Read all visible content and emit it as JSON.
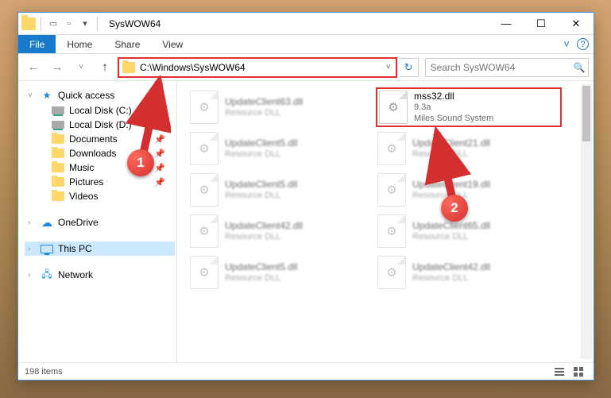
{
  "window": {
    "title": "SysWOW64"
  },
  "ribbon": {
    "file": "File",
    "tabs": [
      "Home",
      "Share",
      "View"
    ]
  },
  "nav": {
    "back_enabled": false,
    "forward_enabled": false,
    "up_enabled": true,
    "path": "C:\\Windows\\SysWOW64",
    "search_placeholder": "Search SysWOW64"
  },
  "sidebar": {
    "quick_access": {
      "label": "Quick access"
    },
    "quick_items": [
      {
        "label": "Local Disk (C:)",
        "pinned": true,
        "type": "drive"
      },
      {
        "label": "Local Disk (D:)",
        "pinned": true,
        "type": "drive"
      },
      {
        "label": "Documents",
        "pinned": true,
        "type": "folder"
      },
      {
        "label": "Downloads",
        "pinned": true,
        "type": "folder"
      },
      {
        "label": "Music",
        "pinned": true,
        "type": "folder"
      },
      {
        "label": "Pictures",
        "pinned": true,
        "type": "folder"
      },
      {
        "label": "Videos",
        "pinned": false,
        "type": "folder"
      }
    ],
    "onedrive": {
      "label": "OneDrive"
    },
    "thispc": {
      "label": "This PC",
      "selected": true
    },
    "network": {
      "label": "Network"
    }
  },
  "files": {
    "highlighted": {
      "name": "mss32.dll",
      "line2": "9.3a",
      "line3": "Miles Sound System"
    },
    "others": [
      {
        "name": "UpdateClient63.dll",
        "sub": "Resource DLL"
      },
      {
        "name": "UpdateClient5.dll",
        "sub": "Resource DLL"
      },
      {
        "name": "UpdateClient5.dll",
        "sub": "Resource DLL"
      },
      {
        "name": "UpdateClient42.dll",
        "sub": "Resource DLL"
      },
      {
        "name": "UpdateClient5.dll",
        "sub": "Resource DLL"
      },
      {
        "name": "UpdateClient21.dll",
        "sub": "Resource DLL"
      },
      {
        "name": "UpdateClient19.dll",
        "sub": "Resource DLL"
      },
      {
        "name": "UpdateClient65.dll",
        "sub": "Resource DLL"
      },
      {
        "name": "UpdateClient42.dll",
        "sub": "Resource DLL"
      }
    ]
  },
  "status": {
    "items": "198 items"
  },
  "annotations": {
    "one": "1",
    "two": "2"
  }
}
